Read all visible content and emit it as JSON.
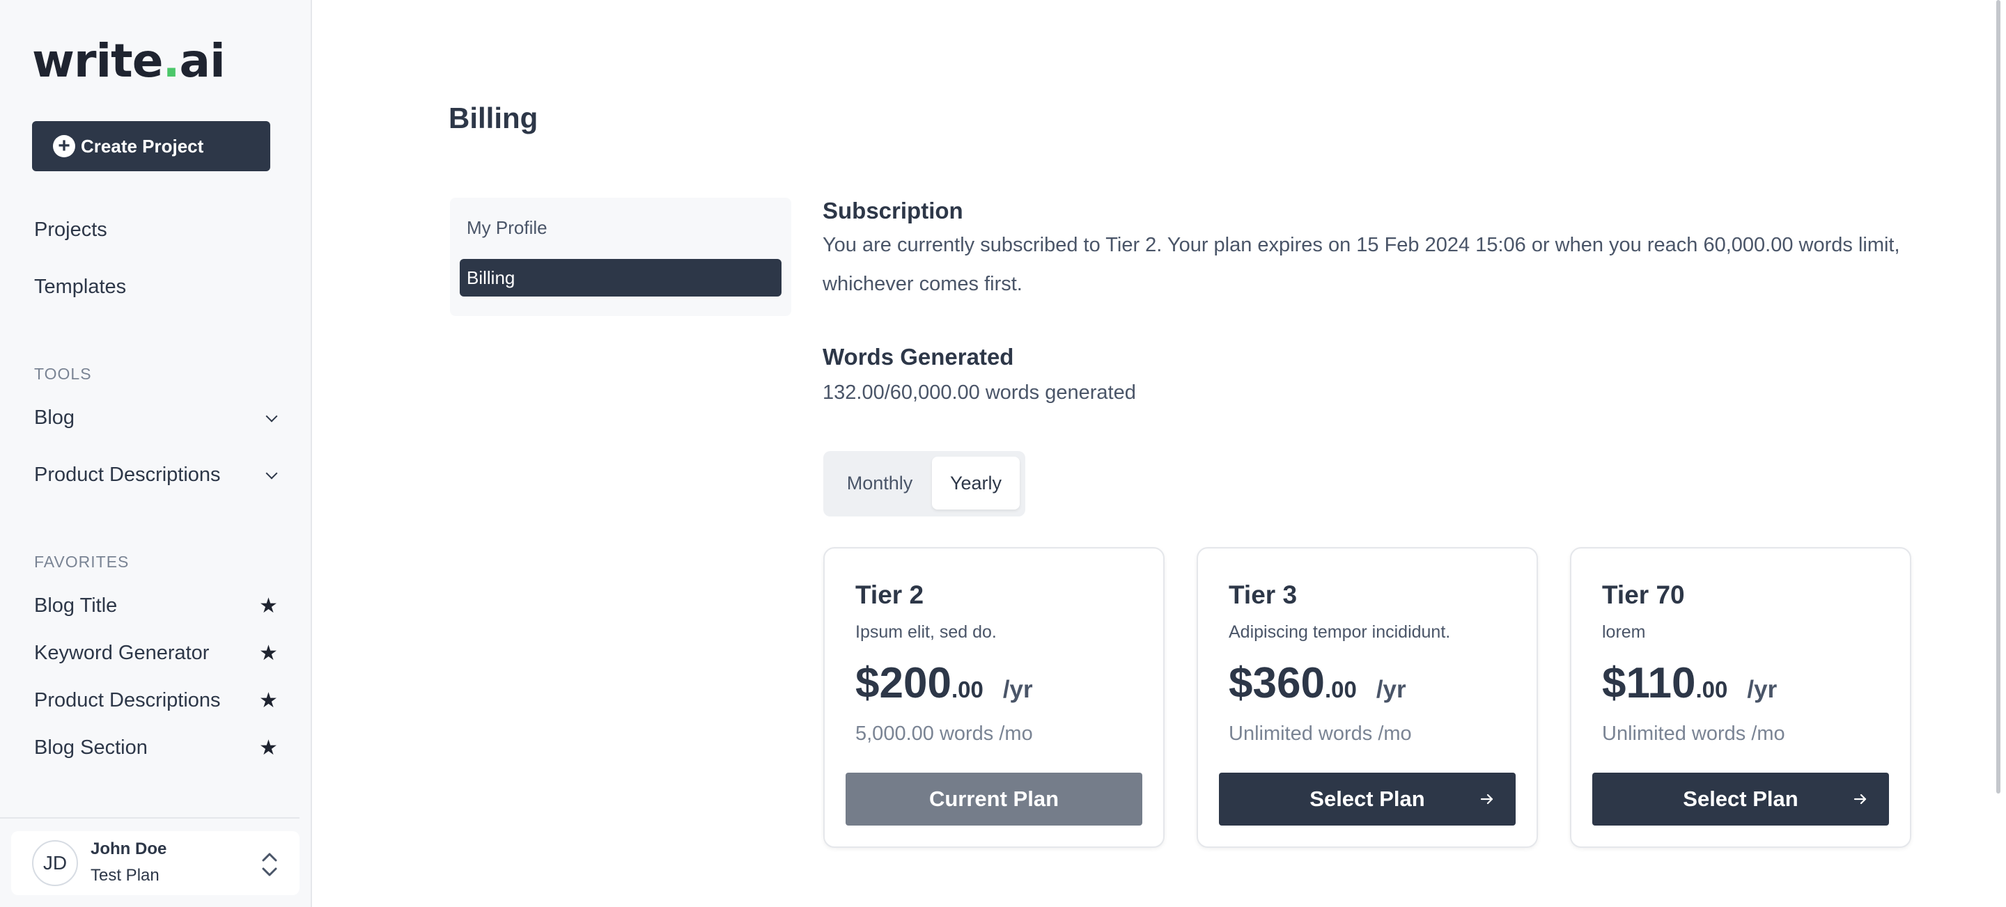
{
  "brand": {
    "logo_pre": "write",
    "logo_dot": ".",
    "logo_post": "ai",
    "accent": "#4cc76a"
  },
  "sidebar": {
    "create_label": "Create Project",
    "nav": [
      {
        "label": "Projects"
      },
      {
        "label": "Templates"
      }
    ],
    "tools_label": "TOOLS",
    "tools": [
      {
        "label": "Blog"
      },
      {
        "label": "Product Descriptions"
      }
    ],
    "favorites_label": "FAVORITES",
    "favorites": [
      {
        "label": "Blog Title"
      },
      {
        "label": "Keyword Generator"
      },
      {
        "label": "Product Descriptions"
      },
      {
        "label": "Blog Section"
      }
    ],
    "user": {
      "initials": "JD",
      "name": "John Doe",
      "plan": "Test Plan"
    }
  },
  "main": {
    "title": "Billing",
    "subnav": [
      {
        "label": "My Profile"
      },
      {
        "label": "Billing"
      }
    ],
    "subscription": {
      "heading": "Subscription",
      "line1": "You are currently subscribed to Tier 2. Your plan expires on 15 Feb 2024 15:06 or when you reach 60,000.00 words limit,",
      "line2": "whichever comes first."
    },
    "words": {
      "heading": "Words Generated",
      "text": "132.00/60,000.00 words generated"
    },
    "billing_toggle": {
      "monthly": "Monthly",
      "yearly": "Yearly",
      "selected": "Yearly"
    },
    "plans": [
      {
        "tier": "Tier 2",
        "desc": "Ipsum elit, sed do.",
        "amount": "$200",
        "cents": ".00",
        "per": "/yr",
        "words": "5,000.00 words /mo",
        "button": "Current Plan"
      },
      {
        "tier": "Tier 3",
        "desc": "Adipiscing tempor incididunt.",
        "amount": "$360",
        "cents": ".00",
        "per": "/yr",
        "words": "Unlimited words /mo",
        "button": "Select Plan"
      },
      {
        "tier": "Tier 70",
        "desc": "lorem",
        "amount": "$110",
        "cents": ".00",
        "per": "/yr",
        "words": "Unlimited words /mo",
        "button": "Select Plan"
      }
    ]
  },
  "icons": {
    "plus": "plus-circle-icon",
    "chevron": "chevron-down-icon",
    "star": "star-icon",
    "updown": "chevron-up-down-icon",
    "arrow": "arrow-right-icon"
  },
  "colors": {
    "primary": "#2d3748",
    "current_plan_btn": "#757d8a",
    "sidebar_bg": "#f7f8fa"
  }
}
